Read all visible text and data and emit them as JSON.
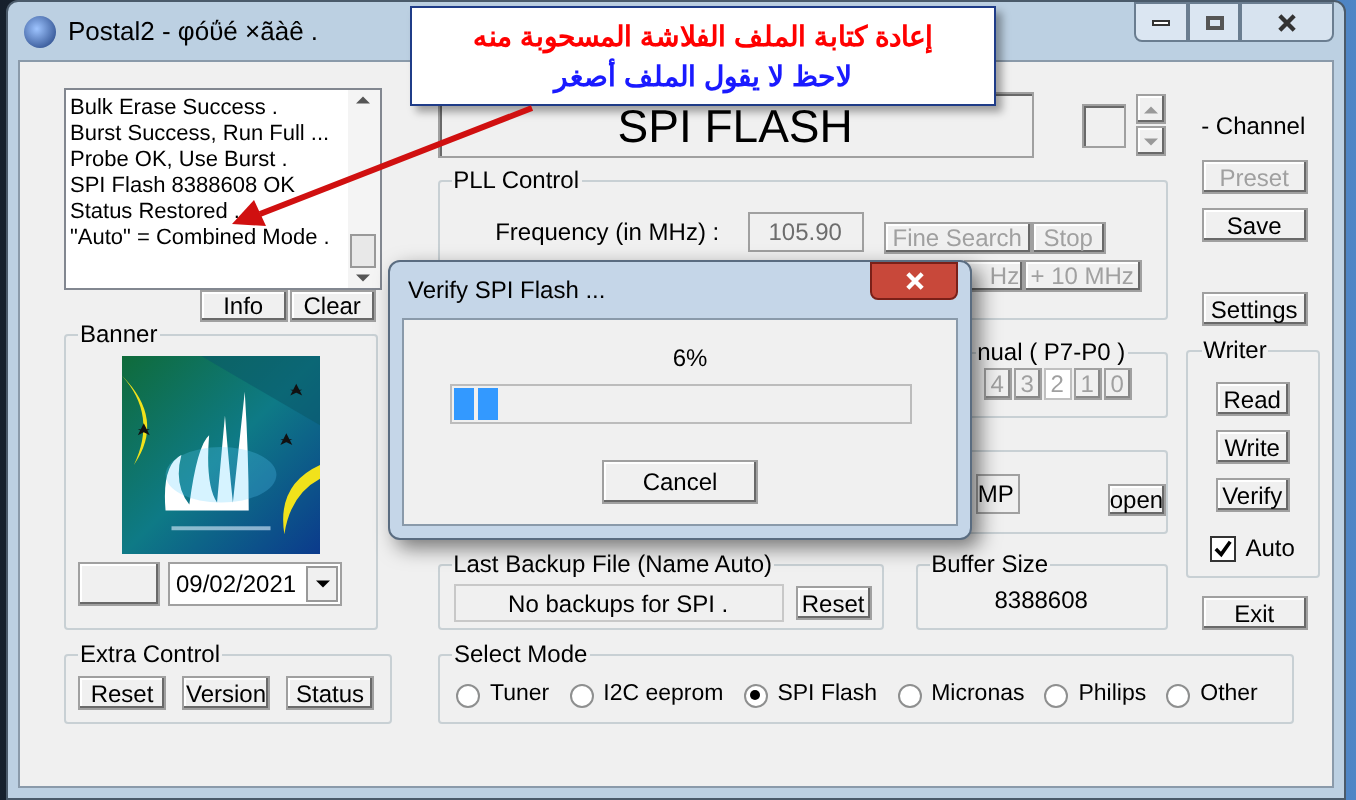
{
  "window": {
    "title": "Postal2 - φóΰé ×ãàê ."
  },
  "callout": {
    "lines": [
      "إعادة كتابة الملف الفلاشة المسحوبة منه",
      "لاحظ لا يقول الملف أصغر"
    ]
  },
  "log": {
    "lines": [
      "Bulk Erase Success .",
      "Burst Success, Run Full ...",
      "Probe OK, Use Burst .",
      "SPI Flash 8388608 OK",
      "Status Restored .",
      "\"Auto\" = Combined Mode ."
    ],
    "buttons": [
      "Info",
      "Clear"
    ]
  },
  "banner": {
    "title": "Banner",
    "date": "09/02/2021"
  },
  "extra_control": {
    "title": "Extra Control",
    "buttons": [
      "Reset",
      "Version",
      "Status"
    ]
  },
  "display": {
    "text": "SPI FLASH"
  },
  "channel": {
    "label": "- Channel"
  },
  "side_buttons": [
    {
      "label": "Preset",
      "disabled": true
    },
    {
      "label": "Save",
      "disabled": false
    },
    {
      "label": "Settings",
      "disabled": false
    }
  ],
  "pll": {
    "title": "PLL Control",
    "frequency_label": "Frequency (in MHz) :",
    "frequency": "105.90",
    "buttons": [
      {
        "label": "Fine Search",
        "disabled": true
      },
      {
        "label": "Stop",
        "disabled": true
      },
      {
        "label": "Hz",
        "disabled": true
      },
      {
        "label": "+ 10 MHz",
        "disabled": true
      }
    ]
  },
  "manual": {
    "title": "nual ( P7-P0 )",
    "bits": [
      {
        "label": "4",
        "selected": false
      },
      {
        "label": "3",
        "selected": false
      },
      {
        "label": "2",
        "selected": true
      },
      {
        "label": "1",
        "selected": false
      },
      {
        "label": "0",
        "selected": false
      }
    ]
  },
  "file_group": {
    "field": "MP",
    "button": "open"
  },
  "writer": {
    "title": "Writer",
    "buttons": [
      "Read",
      "Write",
      "Verify"
    ],
    "auto": {
      "label": "Auto",
      "checked": true
    }
  },
  "exit_button": "Exit",
  "last_backup": {
    "title": "Last Backup File (Name Auto)",
    "value": "No backups for SPI .",
    "button": "Reset"
  },
  "buffer": {
    "title": "Buffer Size",
    "value": "8388608"
  },
  "select_mode": {
    "title": "Select Mode",
    "options": [
      {
        "label": "Tuner",
        "selected": false
      },
      {
        "label": "I2C eeprom",
        "selected": false
      },
      {
        "label": "SPI Flash",
        "selected": true
      },
      {
        "label": "Micronas",
        "selected": false
      },
      {
        "label": "Philips",
        "selected": false
      },
      {
        "label": "Other",
        "selected": false
      }
    ]
  },
  "dialog": {
    "title": "Verify SPI Flash ...",
    "percent": "6%",
    "button": "Cancel"
  }
}
